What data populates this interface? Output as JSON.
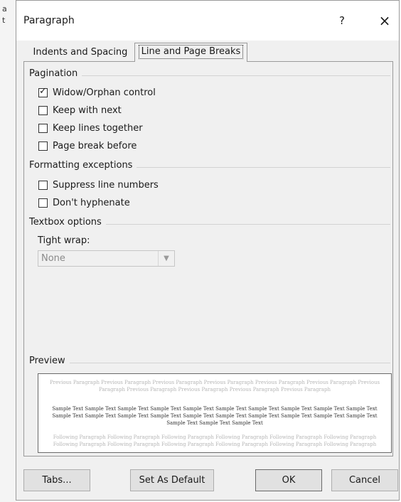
{
  "edge": {
    "line1": "a",
    "line2": "t"
  },
  "dialog": {
    "title": "Paragraph",
    "help_label": "?",
    "close_label": "×"
  },
  "tabs": [
    {
      "label": "Indents and Spacing",
      "active": false,
      "mnemonic": "I"
    },
    {
      "label": "Line and Page Breaks",
      "active": true,
      "mnemonic": "P"
    }
  ],
  "pagination": {
    "heading": "Pagination",
    "options": [
      {
        "label": "Widow/Orphan control",
        "checked": true
      },
      {
        "label": "Keep with next",
        "checked": false
      },
      {
        "label": "Keep lines together",
        "checked": false
      },
      {
        "label": "Page break before",
        "checked": false
      }
    ]
  },
  "formatting": {
    "heading": "Formatting exceptions",
    "options": [
      {
        "label": "Suppress line numbers",
        "checked": false
      },
      {
        "label": "Don't hyphenate",
        "checked": false
      }
    ]
  },
  "textbox": {
    "heading": "Textbox options",
    "tight_wrap_label": "Tight wrap:",
    "tight_wrap_value": "None"
  },
  "preview": {
    "heading": "Preview",
    "previous_text": "Previous Paragraph Previous Paragraph Previous Paragraph Previous Paragraph Previous Paragraph Previous Paragraph Previous Paragraph Previous Paragraph Previous Paragraph Previous Paragraph Previous Paragraph",
    "sample_text": "Sample Text Sample Text Sample Text Sample Text Sample Text Sample Text Sample Text Sample Text Sample Text Sample Text Sample Text Sample Text Sample Text Sample Text Sample Text Sample Text Sample Text Sample Text Sample Text Sample Text Sample Text Sample Text Sample Text",
    "following_text": "Following Paragraph Following Paragraph Following Paragraph Following Paragraph Following Paragraph Following Paragraph Following Paragraph Following Paragraph Following Paragraph Following Paragraph Following Paragraph Following Paragraph"
  },
  "buttons": {
    "tabs": "Tabs...",
    "set_default": "Set As Default",
    "ok": "OK",
    "cancel": "Cancel"
  }
}
